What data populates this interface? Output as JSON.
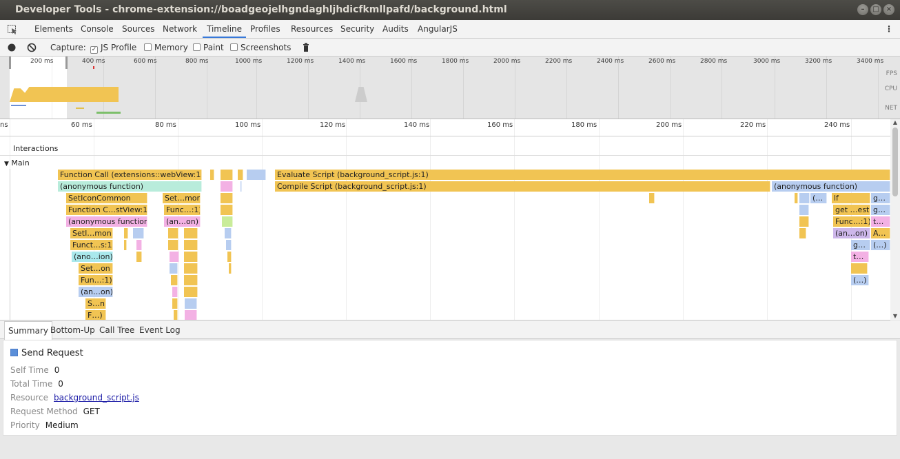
{
  "window": {
    "title": "Developer Tools - chrome-extension://boadgeojelhgndaghljhdicfkmllpafd/background.html"
  },
  "tabs": [
    "Elements",
    "Console",
    "Sources",
    "Network",
    "Timeline",
    "Profiles",
    "Resources",
    "Security",
    "Audits",
    "AngularJS"
  ],
  "selected_tab": "Timeline",
  "capture": {
    "label": "Capture:",
    "js_profile": "JS Profile",
    "memory": "Memory",
    "paint": "Paint",
    "screenshots": "Screenshots"
  },
  "overview": {
    "ticks": [
      "200 ms",
      "400 ms",
      "600 ms",
      "800 ms",
      "1000 ms",
      "1200 ms",
      "1400 ms",
      "1600 ms",
      "1800 ms",
      "2000 ms",
      "2200 ms",
      "2400 ms",
      "2600 ms",
      "2800 ms",
      "3000 ms",
      "3200 ms",
      "3400 ms"
    ],
    "rows": [
      "FPS",
      "CPU",
      "NET"
    ]
  },
  "flame": {
    "ticks": [
      "ns",
      "60 ms",
      "80 ms",
      "100 ms",
      "120 ms",
      "140 ms",
      "160 ms",
      "180 ms",
      "200 ms",
      "220 ms",
      "240 ms"
    ],
    "interactions": "Interactions",
    "main": "Main",
    "main_toggle": "▼",
    "colors": {
      "yellow": "#f1c453",
      "mint": "#b8ecdb",
      "pink": "#f3b1e4",
      "blue": "#b7cdf0",
      "lavender": "#cdb7ea",
      "green": "#c9ec9a",
      "cyan": "#a9e8ec"
    },
    "labels": {
      "function_call": "Function Call (extensions::webView:1)",
      "anon": "(anonymous function)",
      "set_icon_common": "SetIconCommon",
      "set_mon": "Set…mon",
      "function_cstview": "Function C…stView:1)",
      "func_1": "Func…:1)",
      "anon_fn": "(anonymous function)",
      "an_on": "(an…on)",
      "setl_mon": "SetI…mon",
      "funct_s1": "Funct…s:1)",
      "ano_ion": "(ano…ion)",
      "set_on": "Set…on",
      "fun_1": "Fun…:1)",
      "an_on2": "(an…on)",
      "s_n": "S…n",
      "f_paren": "F…)",
      "evaluate": "Evaluate Script (background_script.js:1)",
      "compile": "Compile Script (background_script.js:1)",
      "anon_right": "(anonymous function)",
      "paren_dots": "(…",
      "lf": "lf",
      "get_est": "get …est",
      "g_dots": "g…",
      "func_1b": "Func…:1)",
      "t_dots": "t…",
      "an_on3": "(an…on)",
      "a_dots": "A…",
      "g_dots2": "g…",
      "paren2": "(…)",
      "t_dots2": "t…",
      "paren3": "(…)"
    }
  },
  "bottom_tabs": [
    "Summary",
    "Bottom-Up",
    "Call Tree",
    "Event Log"
  ],
  "summary": {
    "title": "Send Request",
    "swatch_color": "#5b8fd9",
    "self_time_label": "Self Time",
    "self_time": "0",
    "total_time_label": "Total Time",
    "total_time": "0",
    "resource_label": "Resource",
    "resource": "background_script.js",
    "request_method_label": "Request Method",
    "request_method": "GET",
    "priority_label": "Priority",
    "priority": "Medium"
  }
}
